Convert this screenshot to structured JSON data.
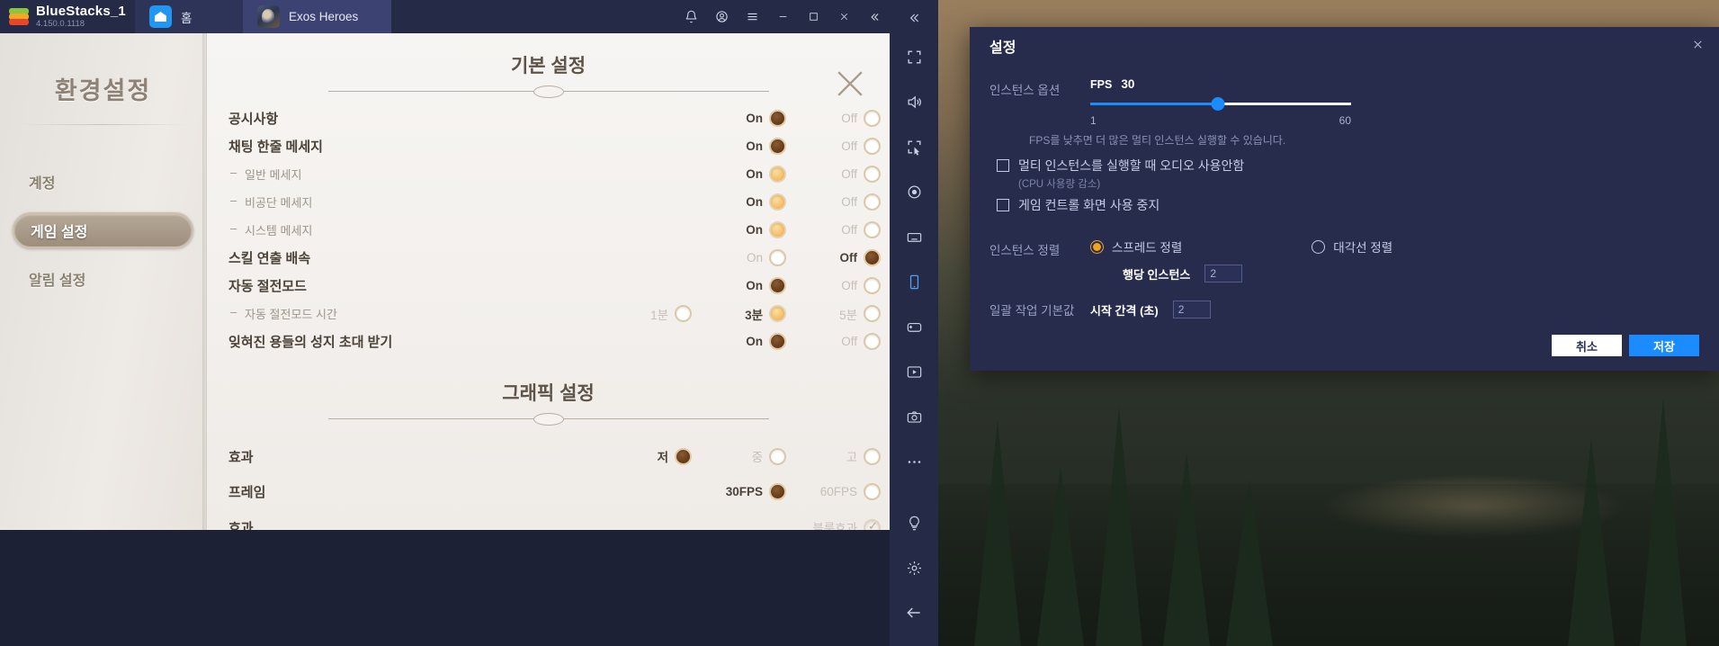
{
  "titlebar": {
    "app_name": "BlueStacks_1",
    "version": "4.150.0.1118",
    "tabs": [
      {
        "label": "홈",
        "icon": "home-icon"
      },
      {
        "label": "Exos Heroes",
        "icon": "game-thumbnail-icon"
      }
    ],
    "buttons": [
      "notification-bell",
      "account-circle",
      "hamburger-menu",
      "minimize",
      "maximize",
      "close",
      "collapse-sidebar"
    ]
  },
  "game": {
    "sidebar": {
      "title": "환경설정",
      "items": [
        {
          "label": "계정",
          "selected": false
        },
        {
          "label": "게임 설정",
          "selected": true
        },
        {
          "label": "알림 설정",
          "selected": false
        }
      ]
    },
    "sections": [
      {
        "title": "기본 설정",
        "rows": [
          {
            "label": "공시사항",
            "sub": false,
            "options": [
              {
                "text": "On",
                "state": "selected-dark"
              },
              {
                "text": "Off",
                "state": "empty"
              }
            ]
          },
          {
            "label": "채팅 한줄 메세지",
            "sub": false,
            "options": [
              {
                "text": "On",
                "state": "selected-dark"
              },
              {
                "text": "Off",
                "state": "empty"
              }
            ]
          },
          {
            "label": "일반 메세지",
            "sub": true,
            "options": [
              {
                "text": "On",
                "state": "selected-amber"
              },
              {
                "text": "Off",
                "state": "empty"
              }
            ]
          },
          {
            "label": "비공단 메세지",
            "sub": true,
            "options": [
              {
                "text": "On",
                "state": "selected-amber"
              },
              {
                "text": "Off",
                "state": "empty"
              }
            ]
          },
          {
            "label": "시스템 메세지",
            "sub": true,
            "options": [
              {
                "text": "On",
                "state": "selected-amber"
              },
              {
                "text": "Off",
                "state": "empty"
              }
            ]
          },
          {
            "label": "스킬 연출 배속",
            "sub": false,
            "options": [
              {
                "text": "On",
                "state": "dim-empty"
              },
              {
                "text": "Off",
                "state": "selected-dark"
              }
            ]
          },
          {
            "label": "자동 절전모드",
            "sub": false,
            "options": [
              {
                "text": "On",
                "state": "selected-dark"
              },
              {
                "text": "Off",
                "state": "empty"
              }
            ]
          },
          {
            "label": "자동 절전모드 시간",
            "sub": true,
            "options": [
              {
                "text": "1분",
                "state": "dim-empty"
              },
              {
                "text": "3분",
                "state": "selected-amber"
              },
              {
                "text": "5분",
                "state": "dim-empty"
              }
            ]
          },
          {
            "label": "잊혀진 용들의 성지 초대 받기",
            "sub": false,
            "options": [
              {
                "text": "On",
                "state": "selected-dark"
              },
              {
                "text": "Off",
                "state": "empty"
              }
            ]
          }
        ]
      },
      {
        "title": "그래픽 설정",
        "rows": [
          {
            "label": "효과",
            "sub": false,
            "options": [
              {
                "text": "저",
                "state": "selected-dark"
              },
              {
                "text": "중",
                "state": "dim-empty"
              },
              {
                "text": "고",
                "state": "dim-empty"
              }
            ]
          },
          {
            "label": "프레임",
            "sub": false,
            "options": [
              {
                "text": "30FPS",
                "state": "selected-dark"
              },
              {
                "text": "60FPS",
                "state": "dim-empty"
              }
            ]
          },
          {
            "label": "효과",
            "sub": false,
            "options": [
              {
                "text": "블룸효과",
                "state": "checked"
              }
            ]
          }
        ]
      }
    ]
  },
  "sidebar_tools": [
    "fullscreen-icon",
    "volume-icon",
    "resize-cursor-icon",
    "location-icon",
    "keyboard-icon",
    "phone-icon",
    "gamepad-icon",
    "macro-icon",
    "camera-icon",
    "more-icon",
    "brightness-icon",
    "gear-icon",
    "back-arrow-icon"
  ],
  "dialog": {
    "title": "설정",
    "close_icon": "close-icon",
    "instance_options": {
      "label": "인스턴스 옵션",
      "fps_name": "FPS",
      "fps_value": "30",
      "fps_min": "1",
      "fps_max": "60",
      "fps_percent": 49,
      "hint": "FPS를 낮추면 더 많은 멀티 인스턴스 실행할 수 있습니다.",
      "checkboxes": [
        {
          "label": "멀티 인스턴스를 실행할 때 오디오 사용안함",
          "note": "(CPU 사용량 감소)",
          "checked": false
        },
        {
          "label": "게임 컨트롤 화면 사용 중지",
          "note": "",
          "checked": false
        }
      ]
    },
    "instance_align": {
      "label": "인스턴스 정렬",
      "options": [
        {
          "label": "스프레드 정렬",
          "selected": true
        },
        {
          "label": "대각선 정렬",
          "selected": false
        }
      ],
      "per_row_label": "행당 인스턴스",
      "per_row_value": "2"
    },
    "batch": {
      "label": "일괄 작업 기본값",
      "interval_label": "시작 간격 (초)",
      "interval_value": "2"
    },
    "buttons": {
      "cancel": "취소",
      "save": "저장"
    },
    "accent": "#1a8cff",
    "radio_accent": "#f2a41f"
  }
}
